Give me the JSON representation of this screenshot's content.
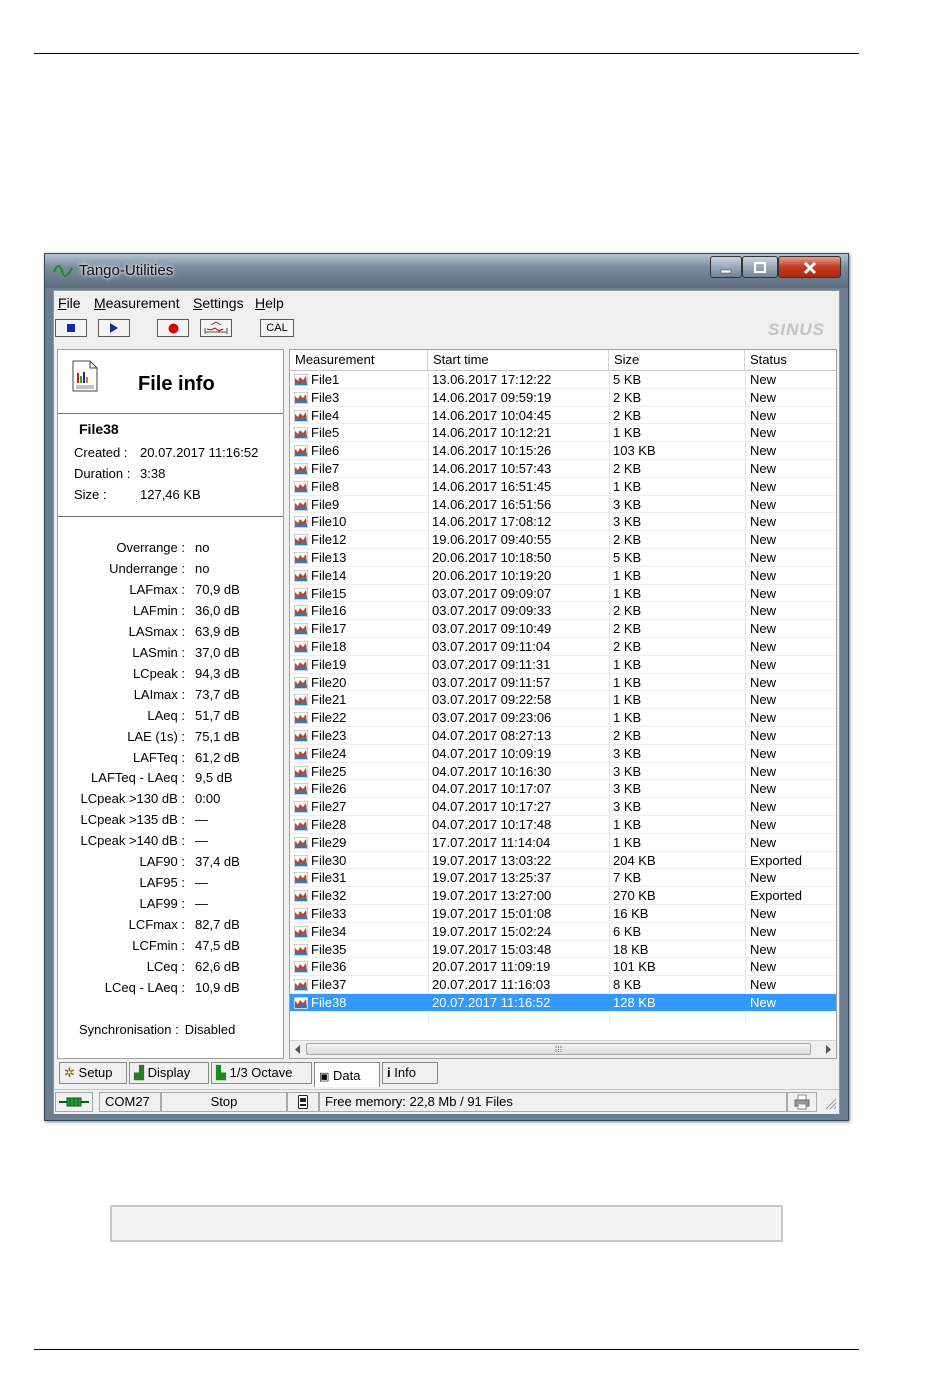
{
  "window": {
    "title": "Tango-Utilities"
  },
  "menu": [
    "File",
    "Measurement",
    "Settings",
    "Help"
  ],
  "toolbar": {
    "cal_label": "CAL",
    "logo": "SINUS"
  },
  "file_info": {
    "title": "File info",
    "name": "File38",
    "created_label": "Created :",
    "created": "20.07.2017 11:16:52",
    "duration_label": "Duration :",
    "duration": "3:38",
    "size_label": "Size :",
    "size": "127,46 KB",
    "stats": [
      {
        "k": "Overrange :",
        "v": "no"
      },
      {
        "k": "Underrange :",
        "v": "no"
      },
      {
        "k": "LAFmax :",
        "v": "70,9 dB"
      },
      {
        "k": "LAFmin :",
        "v": "36,0 dB"
      },
      {
        "k": "LASmax :",
        "v": "63,9 dB"
      },
      {
        "k": "LASmin :",
        "v": "37,0 dB"
      },
      {
        "k": "LCpeak :",
        "v": "94,3 dB"
      },
      {
        "k": "LAImax :",
        "v": "73,7 dB"
      },
      {
        "k": "LAeq :",
        "v": "51,7 dB"
      },
      {
        "k": "LAE (1s) :",
        "v": "75,1 dB"
      },
      {
        "k": "LAFTeq :",
        "v": "61,2 dB"
      },
      {
        "k": "LAFTeq - LAeq :",
        "v": "9,5 dB"
      },
      {
        "k": "LCpeak >130 dB :",
        "v": "0:00"
      },
      {
        "k": "LCpeak >135 dB :",
        "v": "—"
      },
      {
        "k": "LCpeak >140 dB :",
        "v": "—"
      },
      {
        "k": "LAF90 :",
        "v": "37,4 dB"
      },
      {
        "k": "LAF95 :",
        "v": "—"
      },
      {
        "k": "LAF99 :",
        "v": "—"
      },
      {
        "k": "LCFmax :",
        "v": "82,7 dB"
      },
      {
        "k": "LCFmin :",
        "v": "47,5 dB"
      },
      {
        "k": "LCeq :",
        "v": "62,6 dB"
      },
      {
        "k": "LCeq - LAeq :",
        "v": "10,9 dB"
      }
    ],
    "sync_label": "Synchronisation :",
    "sync": "Disabled"
  },
  "table": {
    "columns": [
      "Measurement",
      "Start time",
      "Size",
      "Status"
    ],
    "rows": [
      [
        "File1",
        "13.06.2017 17:12:22",
        "5 KB",
        "New"
      ],
      [
        "File3",
        "14.06.2017 09:59:19",
        "2 KB",
        "New"
      ],
      [
        "File4",
        "14.06.2017 10:04:45",
        "2 KB",
        "New"
      ],
      [
        "File5",
        "14.06.2017 10:12:21",
        "1 KB",
        "New"
      ],
      [
        "File6",
        "14.06.2017 10:15:26",
        "103 KB",
        "New"
      ],
      [
        "File7",
        "14.06.2017 10:57:43",
        "2 KB",
        "New"
      ],
      [
        "File8",
        "14.06.2017 16:51:45",
        "1 KB",
        "New"
      ],
      [
        "File9",
        "14.06.2017 16:51:56",
        "3 KB",
        "New"
      ],
      [
        "File10",
        "14.06.2017 17:08:12",
        "3 KB",
        "New"
      ],
      [
        "File12",
        "19.06.2017 09:40:55",
        "2 KB",
        "New"
      ],
      [
        "File13",
        "20.06.2017 10:18:50",
        "5 KB",
        "New"
      ],
      [
        "File14",
        "20.06.2017 10:19:20",
        "1 KB",
        "New"
      ],
      [
        "File15",
        "03.07.2017 09:09:07",
        "1 KB",
        "New"
      ],
      [
        "File16",
        "03.07.2017 09:09:33",
        "2 KB",
        "New"
      ],
      [
        "File17",
        "03.07.2017 09:10:49",
        "2 KB",
        "New"
      ],
      [
        "File18",
        "03.07.2017 09:11:04",
        "2 KB",
        "New"
      ],
      [
        "File19",
        "03.07.2017 09:11:31",
        "1 KB",
        "New"
      ],
      [
        "File20",
        "03.07.2017 09:11:57",
        "1 KB",
        "New"
      ],
      [
        "File21",
        "03.07.2017 09:22:58",
        "1 KB",
        "New"
      ],
      [
        "File22",
        "03.07.2017 09:23:06",
        "1 KB",
        "New"
      ],
      [
        "File23",
        "04.07.2017 08:27:13",
        "2 KB",
        "New"
      ],
      [
        "File24",
        "04.07.2017 10:09:19",
        "3 KB",
        "New"
      ],
      [
        "File25",
        "04.07.2017 10:16:30",
        "3 KB",
        "New"
      ],
      [
        "File26",
        "04.07.2017 10:17:07",
        "3 KB",
        "New"
      ],
      [
        "File27",
        "04.07.2017 10:17:27",
        "3 KB",
        "New"
      ],
      [
        "File28",
        "04.07.2017 10:17:48",
        "1 KB",
        "New"
      ],
      [
        "File29",
        "17.07.2017 11:14:04",
        "1 KB",
        "New"
      ],
      [
        "File30",
        "19.07.2017 13:03:22",
        "204 KB",
        "Exported"
      ],
      [
        "File31",
        "19.07.2017 13:25:37",
        "7 KB",
        "New"
      ],
      [
        "File32",
        "19.07.2017 13:27:00",
        "270 KB",
        "Exported"
      ],
      [
        "File33",
        "19.07.2017 15:01:08",
        "16 KB",
        "New"
      ],
      [
        "File34",
        "19.07.2017 15:02:24",
        "6 KB",
        "New"
      ],
      [
        "File35",
        "19.07.2017 15:03:48",
        "18 KB",
        "New"
      ],
      [
        "File36",
        "20.07.2017 11:09:19",
        "101 KB",
        "New"
      ],
      [
        "File37",
        "20.07.2017 11:16:03",
        "8 KB",
        "New"
      ],
      [
        "File38",
        "20.07.2017 11:16:52",
        "128 KB",
        "New"
      ]
    ],
    "selected_index": 35
  },
  "tabs": [
    "Setup",
    "Display",
    "1/3 Octave",
    "Data",
    "Info"
  ],
  "active_tab": "Data",
  "status": {
    "port": "COM27",
    "state": "Stop",
    "memory": "Free memory: 22,8 Mb  /  91 Files"
  },
  "colors": {
    "selection": "#3399ff",
    "titlebar": "#7a8b9d",
    "close_button": "#c43b1f"
  }
}
